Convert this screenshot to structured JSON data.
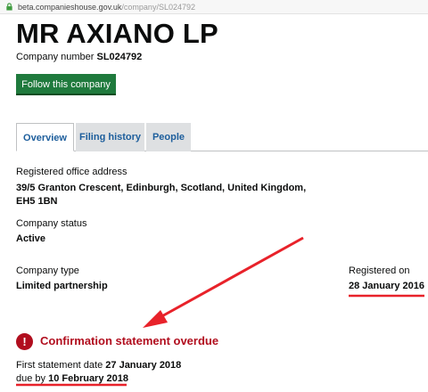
{
  "browser": {
    "url_host": "beta.companieshouse.gov.uk",
    "url_path": "/company/SL024792"
  },
  "company": {
    "name": "MR AXIANO LP",
    "number_label": "Company number",
    "number": "SL024792",
    "follow_button": "Follow this company"
  },
  "tabs": [
    {
      "label": "Overview"
    },
    {
      "label": "Filing history"
    },
    {
      "label": "People"
    }
  ],
  "overview": {
    "address_label": "Registered office address",
    "address_line1": "39/5 Granton Crescent, Edinburgh, Scotland, United Kingdom,",
    "address_line2": "EH5 1BN",
    "status_label": "Company status",
    "status_value": "Active",
    "type_label": "Company type",
    "type_value": "Limited partnership",
    "registered_label": "Registered on",
    "registered_value": "28 January 2016"
  },
  "confirmation": {
    "icon_glyph": "!",
    "title": "Confirmation statement overdue",
    "first_label": "First statement date",
    "first_date": "27 January 2018",
    "due_label": "due by",
    "due_date": "10 February 2018"
  },
  "colors": {
    "follow_button": "#1f7a3d",
    "link": "#1d5e9c",
    "warning": "#b10e1e",
    "annotation": "#e8222a"
  }
}
